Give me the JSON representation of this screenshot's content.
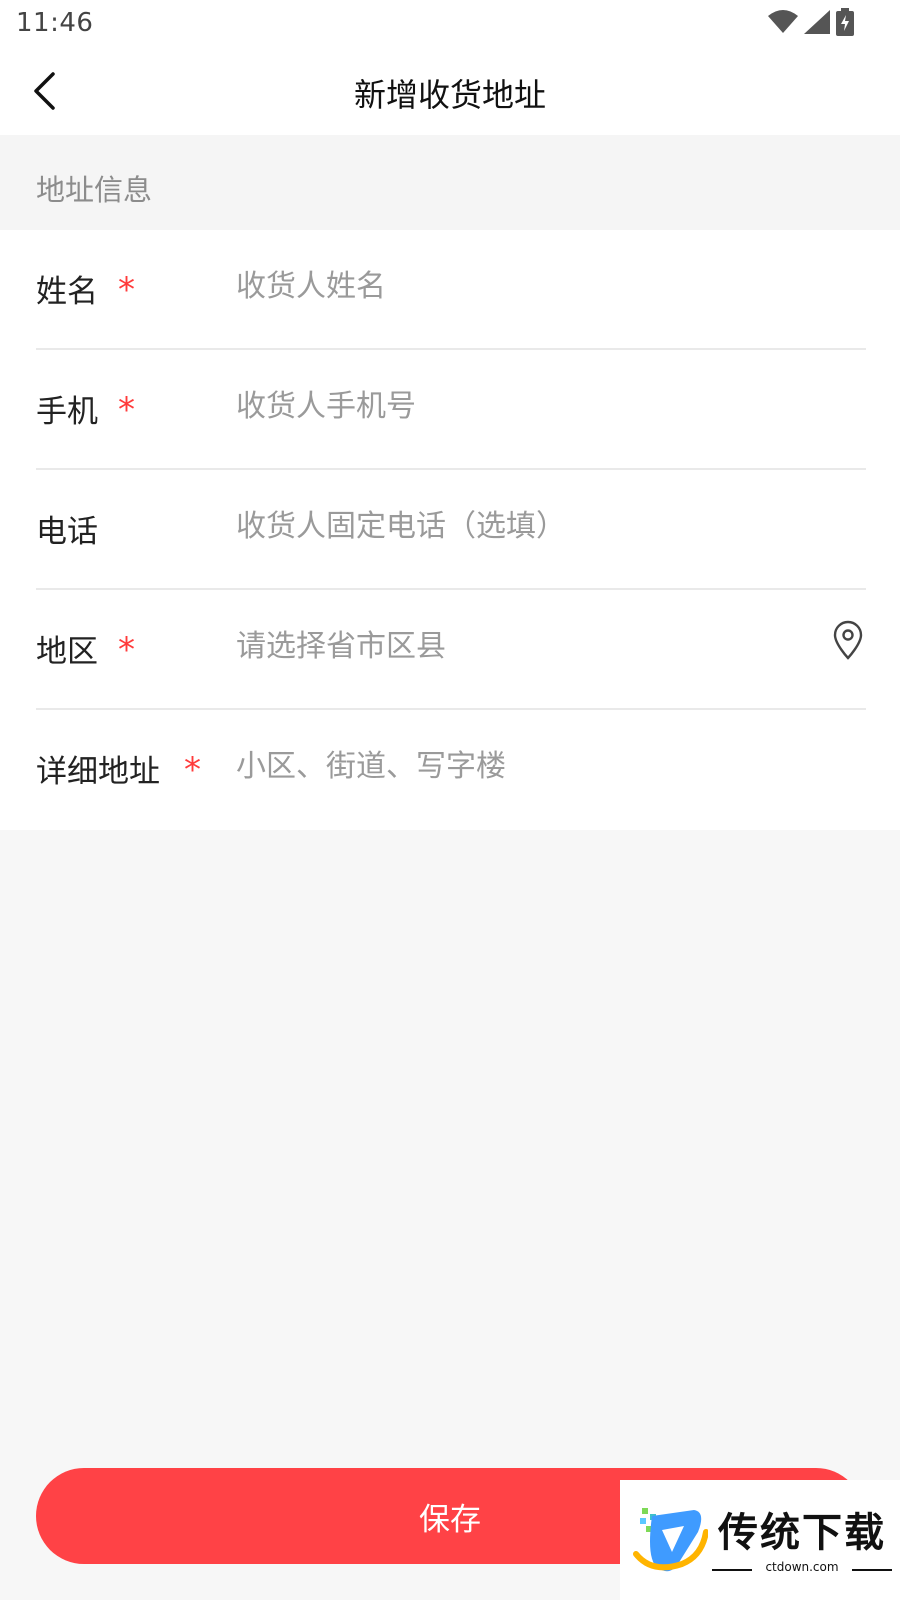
{
  "status_bar": {
    "time": "11:46",
    "icons": [
      "wifi-icon",
      "cellular-signal-icon",
      "battery-charging-icon"
    ]
  },
  "nav": {
    "back_icon": "chevron-left-icon",
    "title": "新增收货地址"
  },
  "section": {
    "title": "地址信息"
  },
  "form": {
    "rows": [
      {
        "label": "姓名",
        "required": true,
        "required_mark": "*",
        "value": "",
        "placeholder": "收货人姓名"
      },
      {
        "label": "手机",
        "required": true,
        "required_mark": "*",
        "value": "",
        "placeholder": "收货人手机号"
      },
      {
        "label": "电话",
        "required": false,
        "value": "",
        "placeholder": "收货人固定电话（选填）"
      },
      {
        "label": "地区",
        "required": true,
        "required_mark": "*",
        "value": "",
        "placeholder": "请选择省市区县",
        "icon": "location-pin-icon"
      },
      {
        "label": "详细地址",
        "required": true,
        "required_mark": "*",
        "value": "",
        "placeholder": "小区、街道、写字楼"
      }
    ]
  },
  "save_button": {
    "label": "保存"
  },
  "watermark": {
    "title": "传统下载",
    "subtitle": "ctdown.com"
  },
  "colors": {
    "accent": "#ff4246",
    "required": "#ff3b3b",
    "placeholder": "#9a9a9a",
    "background": "#f7f7f7"
  }
}
